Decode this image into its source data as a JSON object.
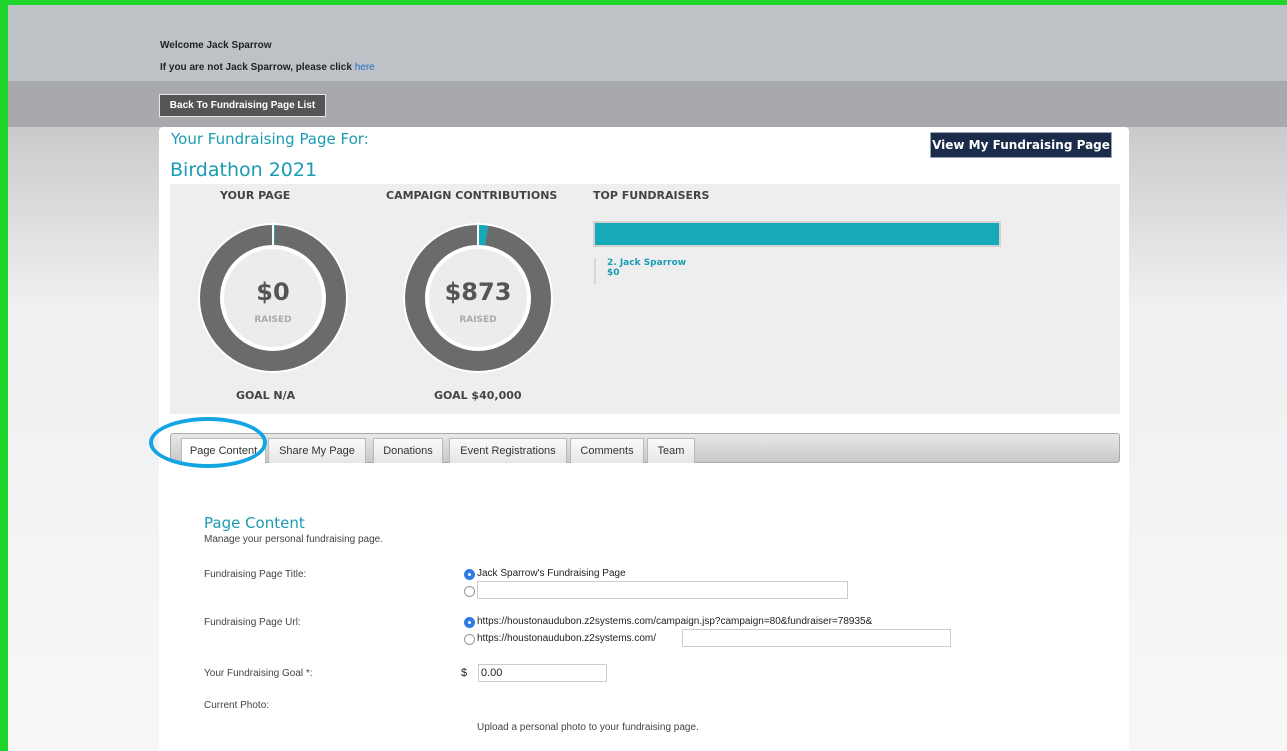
{
  "header": {
    "welcome": "Welcome Jack Sparrow",
    "not_user_text": "If you are not Jack Sparrow, please click",
    "not_user_link": "here",
    "back_button": "Back To Fundraising Page List"
  },
  "page": {
    "label": "Your Fundraising Page For:",
    "campaign": "Birdathon 2021",
    "view_button": "View My Fundraising Page"
  },
  "stats": {
    "your_page": {
      "title": "YOUR PAGE",
      "amount": "$0",
      "raised": "RAISED",
      "goal": "GOAL N/A",
      "progress": 0.005
    },
    "campaign": {
      "title": "CAMPAIGN CONTRIBUTIONS",
      "amount": "$873",
      "raised": "RAISED",
      "goal": "GOAL $40,000",
      "progress": 0.022
    },
    "top": {
      "title": "TOP FUNDRAISERS",
      "rank_name": "2. Jack Sparrow",
      "amount": "$0"
    }
  },
  "tabs": [
    {
      "label": "Page Content",
      "active": true
    },
    {
      "label": "Share My Page"
    },
    {
      "label": "Donations"
    },
    {
      "label": "Event Registrations"
    },
    {
      "label": "Comments"
    },
    {
      "label": "Team"
    }
  ],
  "content": {
    "title": "Page Content",
    "description": "Manage your personal fundraising page.",
    "title_label": "Fundraising Page Title:",
    "title_option_default": "Jack Sparrow's Fundraising Page",
    "title_custom_value": "",
    "url_label": "Fundraising Page Url:",
    "url_option_default": "https://houstonaudubon.z2systems.com/campaign.jsp?campaign=80&fundraiser=78935&",
    "url_option_custom_prefix": "https://houstonaudubon.z2systems.com/",
    "url_custom_value": "",
    "goal_label": "Your Fundraising Goal *:",
    "goal_currency": "$",
    "goal_value": "0.00",
    "photo_label": "Current Photo:",
    "upload_note": "Upload a personal photo to your fundraising page."
  },
  "colors": {
    "accent": "#1b9bb4",
    "dark_button": "#1b2c4b",
    "donut": "#6b6b6b",
    "highlight_ring": "#12a4e3"
  }
}
